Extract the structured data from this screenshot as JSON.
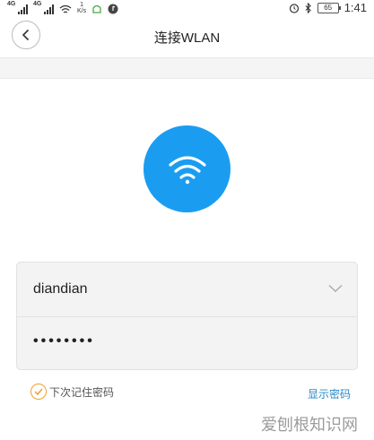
{
  "status_bar": {
    "signal1_label": "4G",
    "signal2_label": "4G",
    "net_speed_value": "1",
    "net_speed_unit": "K/s",
    "battery_level": "65",
    "time": "1:41"
  },
  "header": {
    "title": "连接WLAN"
  },
  "form": {
    "network_name": "diandian",
    "password_masked": "••••••••"
  },
  "options": {
    "remember_label": "下次记住密码",
    "show_password_label": "显示密码"
  },
  "watermark": "爱刨根知识网",
  "colors": {
    "accent_blue": "#1a9df0",
    "check_orange": "#f0a030",
    "link_blue": "#2a88c9"
  }
}
